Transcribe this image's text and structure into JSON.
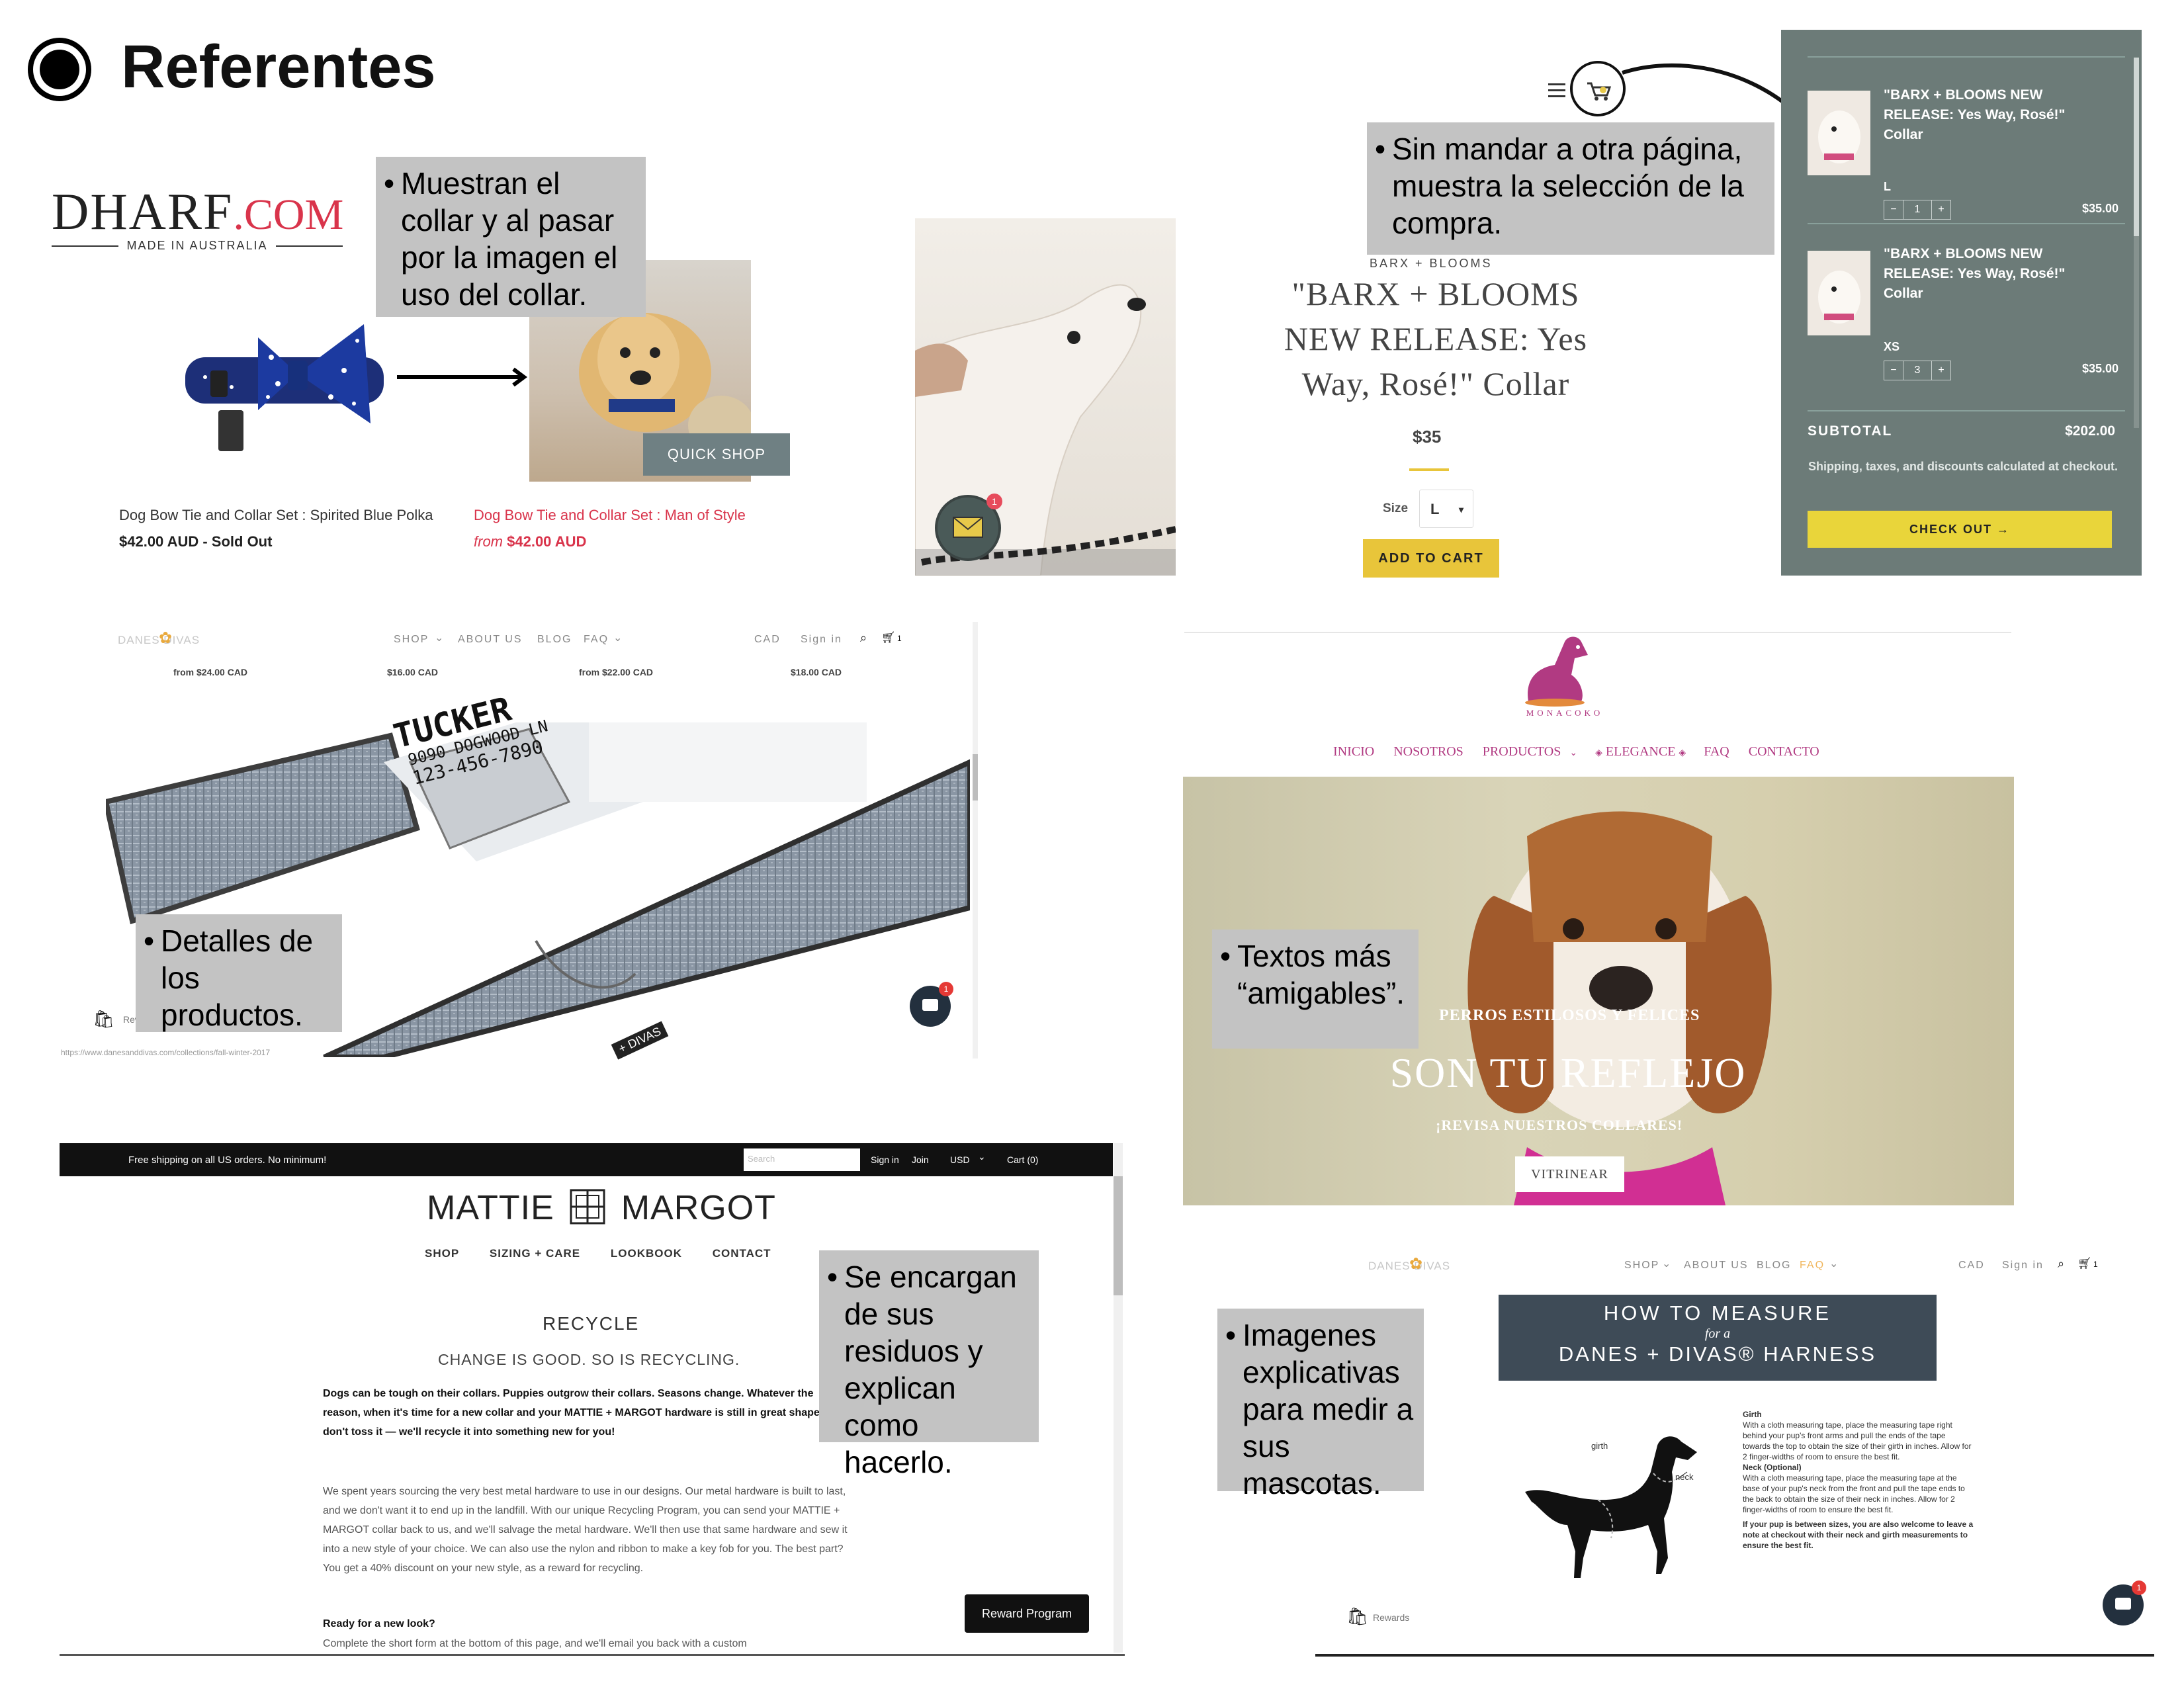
{
  "header": {
    "title": "Referentes"
  },
  "notes": {
    "collar_hover": "Muestran el collar y al pasar por la imagen el uso del collar.",
    "cart_inline": "Sin mandar a otra página, muestra la selección de la compra.",
    "product_details": "Detalles de los productos.",
    "friendly_texts": "Textos más “amigables”.",
    "recycling": "Se encargan de sus residuos y explican como hacerlo.",
    "measure_images": "Imagenes explicativas para medir a sus mascotas."
  },
  "dharf": {
    "logo_main": "DHARF",
    "logo_dot": ".COM",
    "logo_sub": "MADE IN AUSTRALIA",
    "quickshop": "QUICK SHOP",
    "item1_name": "Dog Bow Tie and Collar Set : Spirited Blue Polka",
    "item1_price": "$42.00 AUD - Sold Out",
    "item2_name": "Dog Bow Tie and Collar Set : Man of Style",
    "item2_price_prefix": "from",
    "item2_price": "$42.00 AUD"
  },
  "barx": {
    "brand": "BARX + BLOOMS",
    "title": "\"BARX + BLOOMS NEW RELEASE: Yes Way, Rosé!\" Collar",
    "price": "$35",
    "size_label": "Size",
    "size_value": "L",
    "add_to_cart": "ADD TO CART",
    "badge_count": "1",
    "cart": {
      "items": [
        {
          "name": "\"BARX + BLOOMS NEW RELEASE: Yes Way, Rosé!\" Collar",
          "variant": "L",
          "qty": "1",
          "price": "$35.00"
        },
        {
          "name": "\"BARX + BLOOMS NEW RELEASE: Yes Way, Rosé!\" Collar",
          "variant": "XS",
          "qty": "3",
          "price": "$35.00"
        }
      ],
      "subtotal_label": "SUBTOTAL",
      "subtotal_value": "$202.00",
      "shipping_note": "Shipping, taxes, and discounts calculated at checkout.",
      "checkout": "CHECK OUT →"
    }
  },
  "danes1": {
    "logo": "DANES DIVAS",
    "nav": [
      "SHOP",
      "ABOUT US",
      "BLOG",
      "FAQ"
    ],
    "right": [
      "CAD",
      "Sign in"
    ],
    "cart_count": "1",
    "prices": [
      "from $24.00 CAD",
      "$16.00 CAD",
      "from $22.00 CAD",
      "$18.00 CAD"
    ],
    "tag_lines": [
      "TUCKER",
      "9090 DOGWOOD LN",
      "123-456-7890"
    ],
    "rewards": "Rewards",
    "url": "https://www.danesanddivas.com/collections/fall-winter-2017",
    "chat_badge": "1",
    "strap_text": "+ DIVAS"
  },
  "monacoko": {
    "logo": "MONACOKO",
    "nav": [
      "INICIO",
      "NOSOTROS",
      "PRODUCTOS",
      "ELEGANCE",
      "FAQ",
      "CONTACTO"
    ],
    "hero_kicker": "PERROS ESTILOSOS Y FELICES",
    "hero_title": "SON TU REFLEJO",
    "hero_sub": "¡REVISA NUESTROS COLLARES!",
    "hero_button": "VITRINEAR"
  },
  "mattie": {
    "topbar_text": "Free shipping on all US orders. No minimum!",
    "search_placeholder": "Search",
    "top_links": [
      "Sign in",
      "Join",
      "USD",
      "Cart (0)"
    ],
    "logo_left": "MATTIE",
    "logo_right": "MARGOT",
    "nav": [
      "SHOP",
      "SIZING + CARE",
      "LOOKBOOK",
      "CONTACT"
    ],
    "heading": "RECYCLE",
    "subheading": "CHANGE IS GOOD. SO IS RECYCLING.",
    "para1": "Dogs can be tough on their collars. Puppies outgrow their collars. Seasons change. Whatever the reason, when it's time for a new collar and your MATTIE + MARGOT hardware is still in great shape, don't toss it — we'll recycle it into something new for you!",
    "para2": "We spent years sourcing the very best metal hardware to use in our designs. Our metal hardware is built to last, and we don't want it to end up in the landfill. With our unique Recycling Program, you can send your MATTIE + MARGOT collar back to us, and we'll salvage the metal hardware. We'll then use that same hardware and sew it into a new style of your choice. We can also use the nylon and ribbon to make a key fob for you. The best part? You get a 40% discount on your new style, as a reward for recycling.",
    "para3_title": "Ready for a new look?",
    "para3": "Complete the short form at the bottom of this page, and we'll email you back with a custom",
    "reward_button": "Reward Program"
  },
  "danes2": {
    "logo": "DANES DIVAS",
    "nav": [
      "SHOP",
      "ABOUT US",
      "BLOG",
      "FAQ"
    ],
    "right": [
      "CAD",
      "Sign in"
    ],
    "cart_count": "1",
    "banner_l1": "HOW TO MEASURE",
    "banner_l2": "for a",
    "banner_l3": "DANES + DIVAS® HARNESS",
    "label_girth": "girth",
    "label_neck": "neck",
    "girth_title": "Girth",
    "girth_text": "With a cloth measuring tape, place the measuring tape right behind your pup's front arms and pull the ends of the tape towards the top to obtain the size of their girth in inches. Allow for 2 finger-widths of room to ensure the best fit.",
    "neck_title": "Neck (Optional)",
    "neck_text": "With a cloth measuring tape, place the measuring tape at the base of your pup's neck from the front and pull the tape ends to the back to obtain the size of their neck in inches. Allow for 2 finger-widths of room to ensure the best fit.",
    "between_text": "If your pup is between sizes, you are also welcome to leave a note at checkout with their neck and girth measurements to ensure the best fit.",
    "rewards": "Rewards",
    "chat_badge": "1"
  },
  "colors": {
    "cart_panel": "#6c7b78",
    "checkout_yellow": "#e9d53a",
    "add_to_cart_yellow": "#e8c53a",
    "monacoko_pink": "#b13a82",
    "dharf_red": "#d9344b",
    "note_gray": "#c3c3c3",
    "banner_slate": "#3e4b57"
  }
}
